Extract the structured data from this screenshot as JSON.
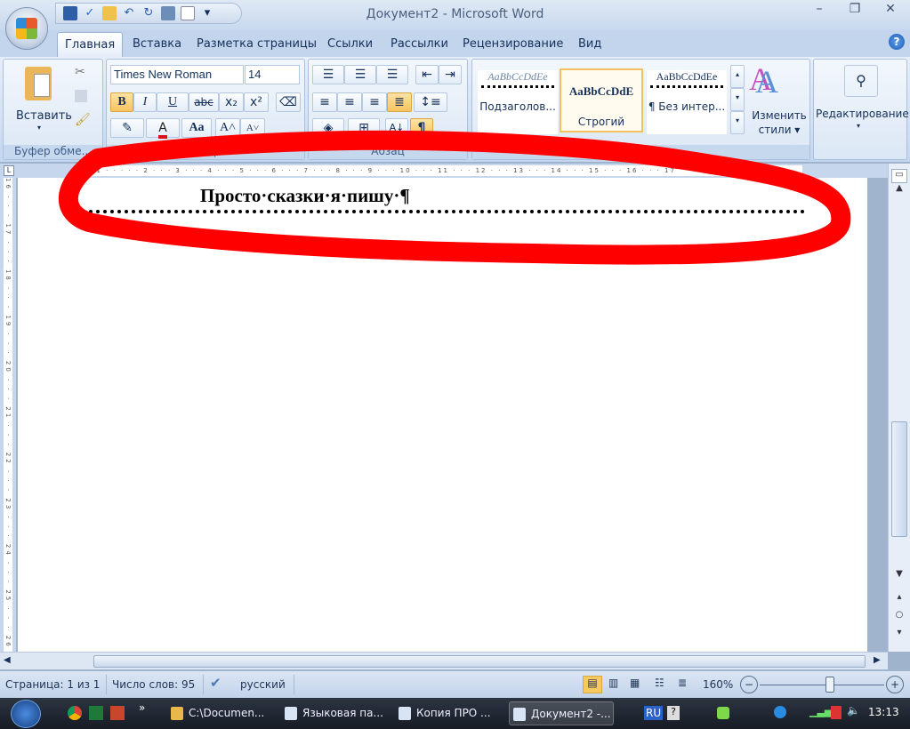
{
  "window": {
    "title": "Документ2 - Microsoft Word",
    "minimize": "–",
    "restore": "❐",
    "close": "✕"
  },
  "qat": {
    "icons": [
      "save-icon",
      "spellcheck-icon",
      "open-icon",
      "undo-icon",
      "redo-icon",
      "print-layout-icon",
      "print-preview-icon",
      "customize-icon"
    ]
  },
  "tabs": [
    "Главная",
    "Вставка",
    "Разметка страницы",
    "Ссылки",
    "Рассылки",
    "Рецензирование",
    "Вид"
  ],
  "clipboard": {
    "paste": "Вставить",
    "label": "Буфер обме..."
  },
  "font": {
    "name": "Times New Roman",
    "size": "14",
    "label": "Шрифт",
    "bold": "B",
    "italic": "I",
    "underline": "U",
    "strike": "abc",
    "sub": "x₂",
    "sup": "x²",
    "case": "Aa",
    "grow": "A˄",
    "shrink": "A˅",
    "color_accent": "#d7141a"
  },
  "paragraph": {
    "label": "Абзац",
    "pilcrow": "¶"
  },
  "styles": {
    "label": "Стили",
    "items": [
      {
        "sample": "AaBbCcDdEe",
        "name": "Подзаголов..."
      },
      {
        "sample": "AaBbCcDdE",
        "name": "Строгий",
        "selected": true
      },
      {
        "sample": "AaBbCcDdEe",
        "name": "¶ Без интер..."
      }
    ],
    "change_line1": "Изменить",
    "change_line2": "стили ▾"
  },
  "editing": {
    "label": "Редактирование"
  },
  "ruler": {
    "h": "· 1 · · · · · 2 · · · 3 · · · 4 · · · 5 · · · 6 · · · 7 · · · 8 · · · 9 · · · 10 · · · 11 · · · 12 · · · 13 · · · 14 · · · 15 · · · 16 · · · 17",
    "v": "16 · · · 17 · · · 18 · · · 19 · · · 20 · · · 21 · · · 22 · · · 23 · · · 24 · · · 25 · · · 26"
  },
  "document": {
    "heading": "Просто·сказки·я·пишу·¶"
  },
  "annotation": {
    "color": "#ff0000"
  },
  "status": {
    "page": "Страница: 1 из 1",
    "words": "Число слов: 95",
    "language": "русский",
    "zoom": "160%",
    "zoom_minus": "−",
    "zoom_plus": "+"
  },
  "taskbar": {
    "items": [
      "C:\\Documen...",
      "Языковая па...",
      "Копия ПРО ...",
      "Документ2 -..."
    ],
    "lang": "RU",
    "clock": "13:13",
    "more": "»"
  }
}
